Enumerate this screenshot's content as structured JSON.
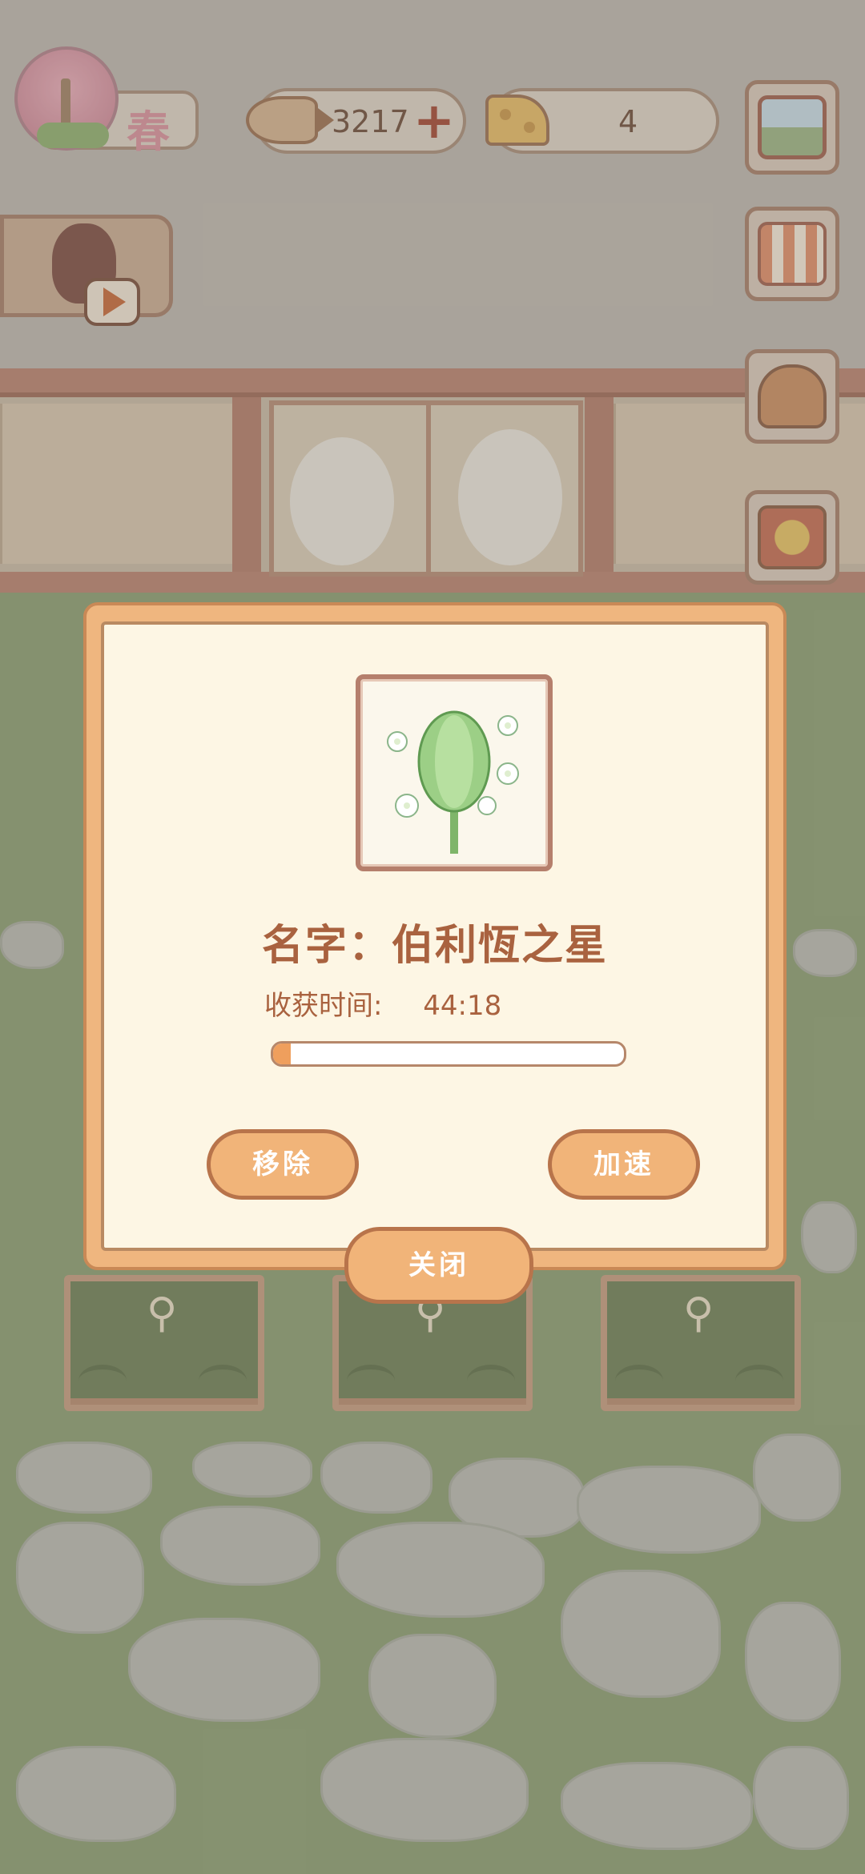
{
  "hud": {
    "season": "春",
    "fish_bones": "3217",
    "cheese": "4"
  },
  "side_menu": [
    {
      "name": "window"
    },
    {
      "name": "shop-stall"
    },
    {
      "name": "flower-basket"
    },
    {
      "name": "trophy"
    }
  ],
  "dialog": {
    "plant_name": "名字：伯利恆之星",
    "harvest_label": "收获时间:",
    "harvest_time": "44:18",
    "progress": 0.05,
    "remove_label": "移除",
    "speed_label": "加速",
    "close_label": "关闭"
  },
  "colors": {
    "accent": "#efb67f",
    "text_brown": "#a9623f",
    "progress_fill": "#ef9f5d"
  }
}
